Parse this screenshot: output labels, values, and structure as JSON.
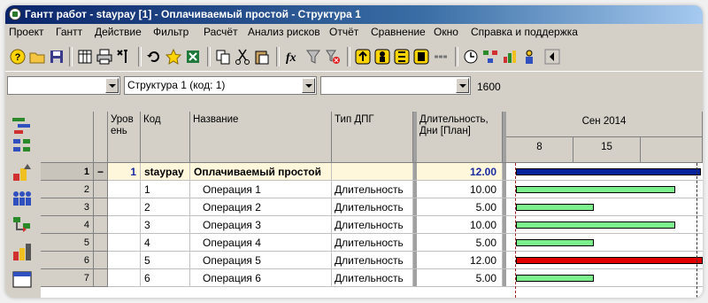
{
  "window": {
    "title": "Гантт работ - staypay [1] - Оплачиваемый простой - Структура 1"
  },
  "menu": [
    "Проект",
    "Гантт",
    "Действие",
    "Фильтр",
    "Расчёт",
    "Анализ рисков",
    "Отчёт",
    "Сравнение",
    "Окно",
    "Справка и поддержка"
  ],
  "selectors": {
    "first_value": "",
    "structure_value": "Структура 1 (код: 1)",
    "third_value": "",
    "duration_value": "1600"
  },
  "columns": {
    "level": "Уров\nень",
    "code": "Код",
    "name": "Название",
    "dpg_type": "Тип ДПГ",
    "duration": "Длительность,\nДни [План]"
  },
  "timeline": {
    "month": "Сен 2014",
    "days": [
      "8",
      "15"
    ]
  },
  "rows": [
    {
      "num": "1",
      "expander": "−",
      "level": "1",
      "code": "staypay",
      "name": "Оплачиваемый простой",
      "type": "",
      "duration": "12.00",
      "summary": true
    },
    {
      "num": "2",
      "expander": "",
      "level": "",
      "code": "1",
      "name": "Операция 1",
      "type": "Длительность",
      "duration": "10.00",
      "summary": false
    },
    {
      "num": "3",
      "expander": "",
      "level": "",
      "code": "2",
      "name": "Операция 2",
      "type": "Длительность",
      "duration": "5.00",
      "summary": false
    },
    {
      "num": "4",
      "expander": "",
      "level": "",
      "code": "3",
      "name": "Операция 3",
      "type": "Длительность",
      "duration": "10.00",
      "summary": false
    },
    {
      "num": "5",
      "expander": "",
      "level": "",
      "code": "4",
      "name": "Операция 4",
      "type": "Длительность",
      "duration": "5.00",
      "summary": false
    },
    {
      "num": "6",
      "expander": "",
      "level": "",
      "code": "5",
      "name": "Операция 5",
      "type": "Длительность",
      "duration": "12.00",
      "summary": false
    },
    {
      "num": "7",
      "expander": "",
      "level": "",
      "code": "6",
      "name": "Операция 6",
      "type": "Длительность",
      "duration": "5.00",
      "summary": false
    }
  ],
  "colors": {
    "summary_bar": "#00219c",
    "task_bar": "#7cf08c",
    "critical_bar": "#e00000"
  },
  "toolbar_icons": [
    "help-icon",
    "open-folder-icon",
    "save-icon",
    "table-icon",
    "print-icon",
    "tools-icon",
    "undo-icon",
    "star-icon",
    "excel-icon",
    "copy-icon",
    "cut-icon",
    "paste-icon",
    "formula-icon",
    "filter-icon",
    "clear-filter-icon",
    "resource-icon-1",
    "resource-icon-2",
    "resource-icon-3",
    "resource-icon-4",
    "link-icon",
    "schedule-icon",
    "resources-tree-icon",
    "chart-icon",
    "people-icon",
    "scroll-left-icon"
  ],
  "sidebar_icons": [
    "gantt-icon",
    "structure-icon",
    "resources-icon",
    "work-resources-icon",
    "team-icon",
    "flow-icon",
    "cost-icon",
    "calendar-icon"
  ]
}
